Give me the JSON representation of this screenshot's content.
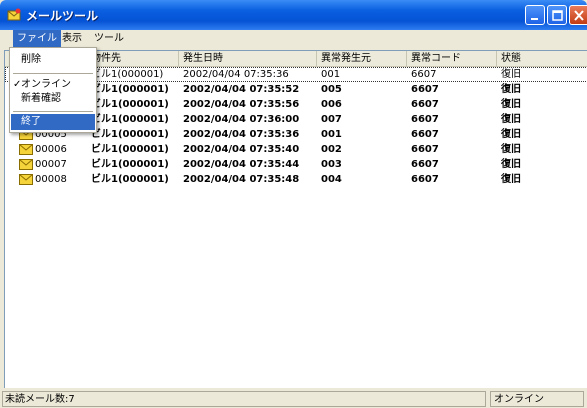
{
  "window": {
    "title": "メールツール"
  },
  "menubar": {
    "items": [
      "ファイル",
      "表示",
      "ツール"
    ]
  },
  "file_menu": {
    "items": [
      {
        "label": "削除",
        "checked": false
      },
      {
        "label": "オンライン",
        "checked": true
      },
      {
        "label": "新着確認",
        "checked": false
      },
      {
        "label": "終了",
        "checked": false
      }
    ],
    "check_glyph": "✓"
  },
  "list": {
    "columns": [
      "",
      "物件先",
      "発生日時",
      "異常発生元",
      "異常コード",
      "状態"
    ],
    "rows": [
      {
        "id": "",
        "property": "ビル1(000001)",
        "datetime": "2002/04/04 07:35:36",
        "source": "001",
        "code": "6607",
        "status": "復旧",
        "unread": false
      },
      {
        "id": "",
        "property": "ビル1(000001)",
        "datetime": "2002/04/04 07:35:52",
        "source": "005",
        "code": "6607",
        "status": "復旧",
        "unread": true
      },
      {
        "id": "",
        "property": "ビル1(000001)",
        "datetime": "2002/04/04 07:35:56",
        "source": "006",
        "code": "6607",
        "status": "復旧",
        "unread": true
      },
      {
        "id": "",
        "property": "ビル1(000001)",
        "datetime": "2002/04/04 07:36:00",
        "source": "007",
        "code": "6607",
        "status": "復旧",
        "unread": true
      },
      {
        "id": "00005",
        "property": "ビル1(000001)",
        "datetime": "2002/04/04 07:35:36",
        "source": "001",
        "code": "6607",
        "status": "復旧",
        "unread": true
      },
      {
        "id": "00006",
        "property": "ビル1(000001)",
        "datetime": "2002/04/04 07:35:40",
        "source": "002",
        "code": "6607",
        "status": "復旧",
        "unread": true
      },
      {
        "id": "00007",
        "property": "ビル1(000001)",
        "datetime": "2002/04/04 07:35:44",
        "source": "003",
        "code": "6607",
        "status": "復旧",
        "unread": true
      },
      {
        "id": "00008",
        "property": "ビル1(000001)",
        "datetime": "2002/04/04 07:35:48",
        "source": "004",
        "code": "6607",
        "status": "復旧",
        "unread": true
      }
    ]
  },
  "statusbar": {
    "unread_label": "未読メール数:7",
    "connection": "オンライン"
  },
  "colors": {
    "title_bar": "#0a5fe0",
    "highlight": "#316ac5",
    "envelope": "#f5d33a"
  }
}
